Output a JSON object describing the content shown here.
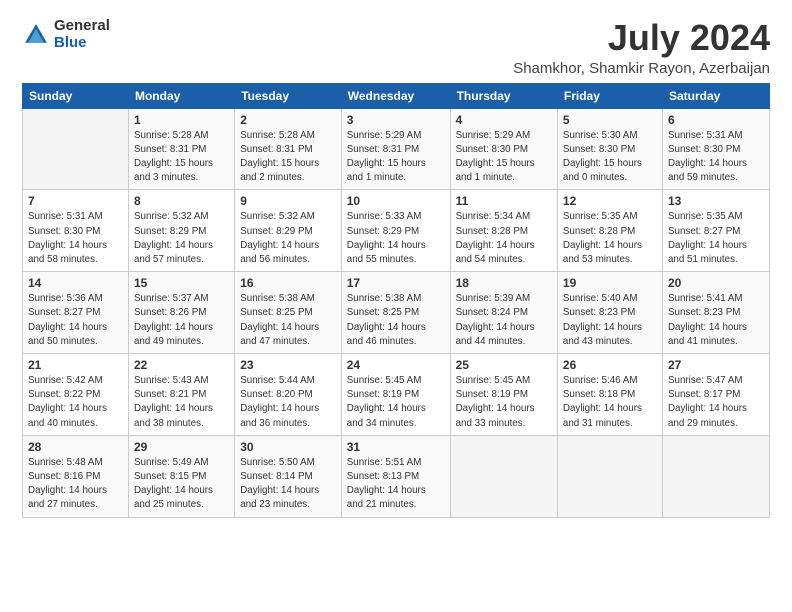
{
  "header": {
    "logo_general": "General",
    "logo_blue": "Blue",
    "title": "July 2024",
    "subtitle": "Shamkhor, Shamkir Rayon, Azerbaijan"
  },
  "weekdays": [
    "Sunday",
    "Monday",
    "Tuesday",
    "Wednesday",
    "Thursday",
    "Friday",
    "Saturday"
  ],
  "weeks": [
    [
      {
        "day": "",
        "info": ""
      },
      {
        "day": "1",
        "info": "Sunrise: 5:28 AM\nSunset: 8:31 PM\nDaylight: 15 hours\nand 3 minutes."
      },
      {
        "day": "2",
        "info": "Sunrise: 5:28 AM\nSunset: 8:31 PM\nDaylight: 15 hours\nand 2 minutes."
      },
      {
        "day": "3",
        "info": "Sunrise: 5:29 AM\nSunset: 8:31 PM\nDaylight: 15 hours\nand 1 minute."
      },
      {
        "day": "4",
        "info": "Sunrise: 5:29 AM\nSunset: 8:30 PM\nDaylight: 15 hours\nand 1 minute."
      },
      {
        "day": "5",
        "info": "Sunrise: 5:30 AM\nSunset: 8:30 PM\nDaylight: 15 hours\nand 0 minutes."
      },
      {
        "day": "6",
        "info": "Sunrise: 5:31 AM\nSunset: 8:30 PM\nDaylight: 14 hours\nand 59 minutes."
      }
    ],
    [
      {
        "day": "7",
        "info": "Sunrise: 5:31 AM\nSunset: 8:30 PM\nDaylight: 14 hours\nand 58 minutes."
      },
      {
        "day": "8",
        "info": "Sunrise: 5:32 AM\nSunset: 8:29 PM\nDaylight: 14 hours\nand 57 minutes."
      },
      {
        "day": "9",
        "info": "Sunrise: 5:32 AM\nSunset: 8:29 PM\nDaylight: 14 hours\nand 56 minutes."
      },
      {
        "day": "10",
        "info": "Sunrise: 5:33 AM\nSunset: 8:29 PM\nDaylight: 14 hours\nand 55 minutes."
      },
      {
        "day": "11",
        "info": "Sunrise: 5:34 AM\nSunset: 8:28 PM\nDaylight: 14 hours\nand 54 minutes."
      },
      {
        "day": "12",
        "info": "Sunrise: 5:35 AM\nSunset: 8:28 PM\nDaylight: 14 hours\nand 53 minutes."
      },
      {
        "day": "13",
        "info": "Sunrise: 5:35 AM\nSunset: 8:27 PM\nDaylight: 14 hours\nand 51 minutes."
      }
    ],
    [
      {
        "day": "14",
        "info": "Sunrise: 5:36 AM\nSunset: 8:27 PM\nDaylight: 14 hours\nand 50 minutes."
      },
      {
        "day": "15",
        "info": "Sunrise: 5:37 AM\nSunset: 8:26 PM\nDaylight: 14 hours\nand 49 minutes."
      },
      {
        "day": "16",
        "info": "Sunrise: 5:38 AM\nSunset: 8:25 PM\nDaylight: 14 hours\nand 47 minutes."
      },
      {
        "day": "17",
        "info": "Sunrise: 5:38 AM\nSunset: 8:25 PM\nDaylight: 14 hours\nand 46 minutes."
      },
      {
        "day": "18",
        "info": "Sunrise: 5:39 AM\nSunset: 8:24 PM\nDaylight: 14 hours\nand 44 minutes."
      },
      {
        "day": "19",
        "info": "Sunrise: 5:40 AM\nSunset: 8:23 PM\nDaylight: 14 hours\nand 43 minutes."
      },
      {
        "day": "20",
        "info": "Sunrise: 5:41 AM\nSunset: 8:23 PM\nDaylight: 14 hours\nand 41 minutes."
      }
    ],
    [
      {
        "day": "21",
        "info": "Sunrise: 5:42 AM\nSunset: 8:22 PM\nDaylight: 14 hours\nand 40 minutes."
      },
      {
        "day": "22",
        "info": "Sunrise: 5:43 AM\nSunset: 8:21 PM\nDaylight: 14 hours\nand 38 minutes."
      },
      {
        "day": "23",
        "info": "Sunrise: 5:44 AM\nSunset: 8:20 PM\nDaylight: 14 hours\nand 36 minutes."
      },
      {
        "day": "24",
        "info": "Sunrise: 5:45 AM\nSunset: 8:19 PM\nDaylight: 14 hours\nand 34 minutes."
      },
      {
        "day": "25",
        "info": "Sunrise: 5:45 AM\nSunset: 8:19 PM\nDaylight: 14 hours\nand 33 minutes."
      },
      {
        "day": "26",
        "info": "Sunrise: 5:46 AM\nSunset: 8:18 PM\nDaylight: 14 hours\nand 31 minutes."
      },
      {
        "day": "27",
        "info": "Sunrise: 5:47 AM\nSunset: 8:17 PM\nDaylight: 14 hours\nand 29 minutes."
      }
    ],
    [
      {
        "day": "28",
        "info": "Sunrise: 5:48 AM\nSunset: 8:16 PM\nDaylight: 14 hours\nand 27 minutes."
      },
      {
        "day": "29",
        "info": "Sunrise: 5:49 AM\nSunset: 8:15 PM\nDaylight: 14 hours\nand 25 minutes."
      },
      {
        "day": "30",
        "info": "Sunrise: 5:50 AM\nSunset: 8:14 PM\nDaylight: 14 hours\nand 23 minutes."
      },
      {
        "day": "31",
        "info": "Sunrise: 5:51 AM\nSunset: 8:13 PM\nDaylight: 14 hours\nand 21 minutes."
      },
      {
        "day": "",
        "info": ""
      },
      {
        "day": "",
        "info": ""
      },
      {
        "day": "",
        "info": ""
      }
    ]
  ]
}
